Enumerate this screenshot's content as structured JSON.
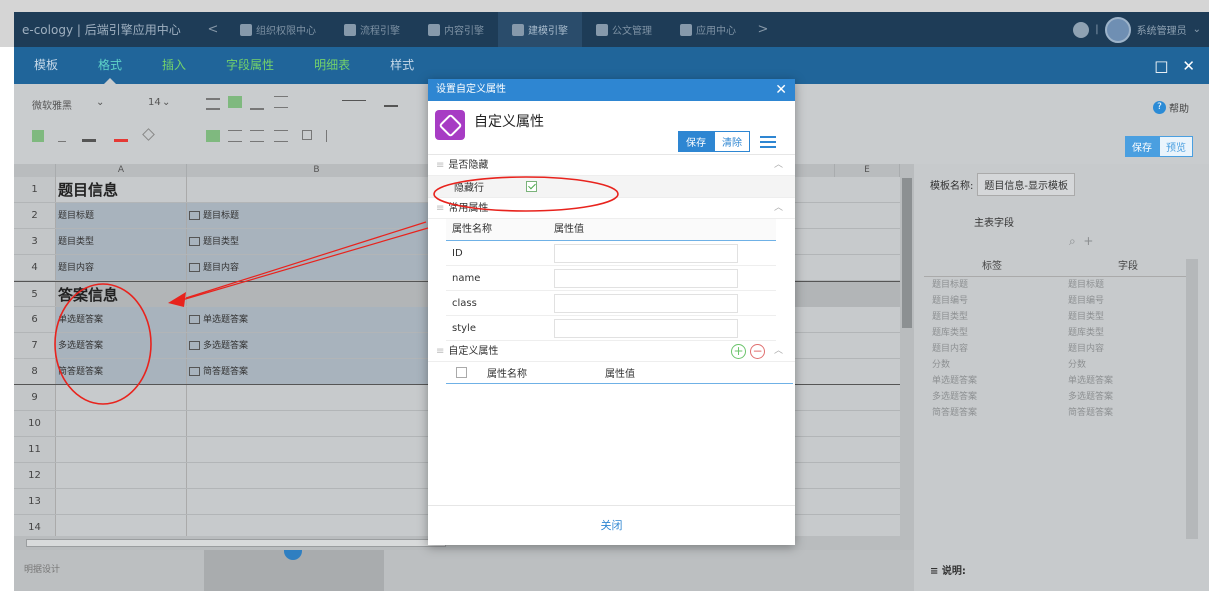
{
  "topbar": {
    "title": "e-cology | 后端引擎应用中心",
    "prev_arrow": "<",
    "next_arrow": ">",
    "nav": [
      {
        "label": "组织权限中心"
      },
      {
        "label": "流程引擎"
      },
      {
        "label": "内容引擎"
      },
      {
        "label": "建模引擎"
      },
      {
        "label": "公文管理"
      },
      {
        "label": "应用中心"
      }
    ],
    "user": "系统管理员",
    "separator": "|"
  },
  "menubar": {
    "items": [
      "模板",
      "格式",
      "插入",
      "字段属性",
      "明细表",
      "样式"
    ],
    "active": "格式",
    "minimize": "□",
    "close": "✕"
  },
  "toolbar": {
    "font_family": "微软雅黑",
    "font_size": "14",
    "help": "帮助",
    "save": "保存",
    "preview": "预览"
  },
  "sheet": {
    "columns": [
      "A",
      "B",
      "E"
    ],
    "rows": [
      {
        "num": "1",
        "a": "题目信息",
        "b": ""
      },
      {
        "num": "2",
        "a": "题目标题",
        "b": "题目标题"
      },
      {
        "num": "3",
        "a": "题目类型",
        "b": "题目类型"
      },
      {
        "num": "4",
        "a": "题目内容",
        "b": "题目内容"
      },
      {
        "num": "5",
        "a": "答案信息",
        "b": ""
      },
      {
        "num": "6",
        "a": "单选题答案",
        "b": "单选题答案"
      },
      {
        "num": "7",
        "a": "多选题答案",
        "b": "多选题答案"
      },
      {
        "num": "8",
        "a": "简答题答案",
        "b": "简答题答案"
      },
      {
        "num": "9",
        "a": "",
        "b": ""
      },
      {
        "num": "10",
        "a": "",
        "b": ""
      },
      {
        "num": "11",
        "a": "",
        "b": ""
      },
      {
        "num": "12",
        "a": "",
        "b": ""
      },
      {
        "num": "13",
        "a": "",
        "b": ""
      },
      {
        "num": "14",
        "a": "",
        "b": ""
      }
    ]
  },
  "footer": {
    "label": "明据设计"
  },
  "right_panel": {
    "template_label": "模板名称:",
    "template_name": "题目信息-显示模板",
    "main_fields": "主表字段",
    "col_label": "标签",
    "col_field": "字段",
    "fields": [
      {
        "label": "题目标题",
        "field": "题目标题"
      },
      {
        "label": "题目编号",
        "field": "题目编号"
      },
      {
        "label": "题目类型",
        "field": "题目类型"
      },
      {
        "label": "题库类型",
        "field": "题库类型"
      },
      {
        "label": "题目内容",
        "field": "题目内容"
      },
      {
        "label": "分数",
        "field": "分数"
      },
      {
        "label": "单选题答案",
        "field": "单选题答案"
      },
      {
        "label": "多选题答案",
        "field": "多选题答案"
      },
      {
        "label": "简答题答案",
        "field": "简答题答案"
      }
    ],
    "note": "说明:"
  },
  "dialog": {
    "title": "设置自定义属性",
    "close": "✕",
    "heading": "自定义属性",
    "save": "保存",
    "clear": "清除",
    "section_hidden": "是否隐藏",
    "hidden_row_label": "隐藏行",
    "hidden_row_checked": true,
    "section_common": "常用属性",
    "col_name": "属性名称",
    "col_value": "属性值",
    "props": [
      {
        "name": "ID",
        "value": ""
      },
      {
        "name": "name",
        "value": ""
      },
      {
        "name": "class",
        "value": ""
      },
      {
        "name": "style",
        "value": ""
      }
    ],
    "section_custom": "自定义属性",
    "add": "+",
    "remove": "−",
    "custom_col_name": "属性名称",
    "custom_col_value": "属性值",
    "footer_close": "关闭"
  },
  "colors": {
    "accent": "#2e86d2",
    "menubar": "#20659a",
    "topbar": "#1e3c57",
    "annotation": "#e8231d"
  }
}
